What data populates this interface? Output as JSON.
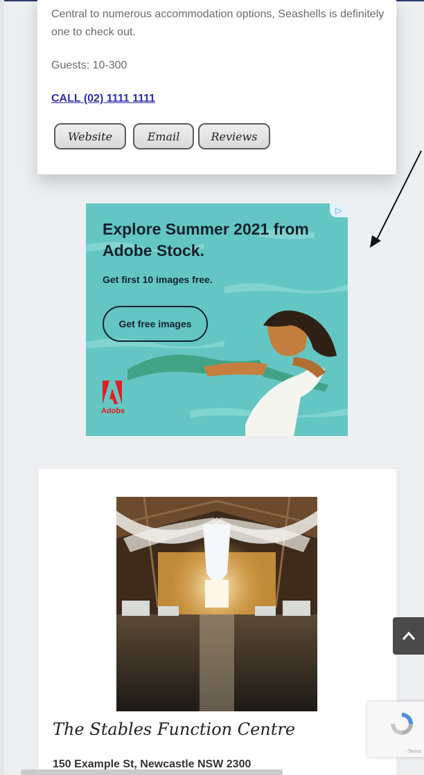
{
  "listing_top": {
    "description": "Central to numerous accommodation options, Seashells is definitely one to check out.",
    "guests": "Guests: 10-300",
    "call": "CALL (02) 1111 1111",
    "buttons": {
      "website": "Website",
      "email": "Email",
      "reviews": "Reviews"
    }
  },
  "ad": {
    "headline": "Explore Summer 2021 from Adobe Stock.",
    "subtext": "Get first 10 images free.",
    "cta": "Get free images",
    "brand": "Adobe",
    "colors": {
      "background": "#63c6c2",
      "text": "#14202e",
      "logo": "#e41c24"
    }
  },
  "listing_bottom": {
    "title": "The Stables Function Centre",
    "address": "150 Example St, Newcastle NSW 2300"
  },
  "widgets": {
    "scroll_top_icon": "chevron-up-icon",
    "recaptcha_terms": "- Terms"
  },
  "colors": {
    "link": "#2d2ea8",
    "page_bg": "#eceef1"
  }
}
